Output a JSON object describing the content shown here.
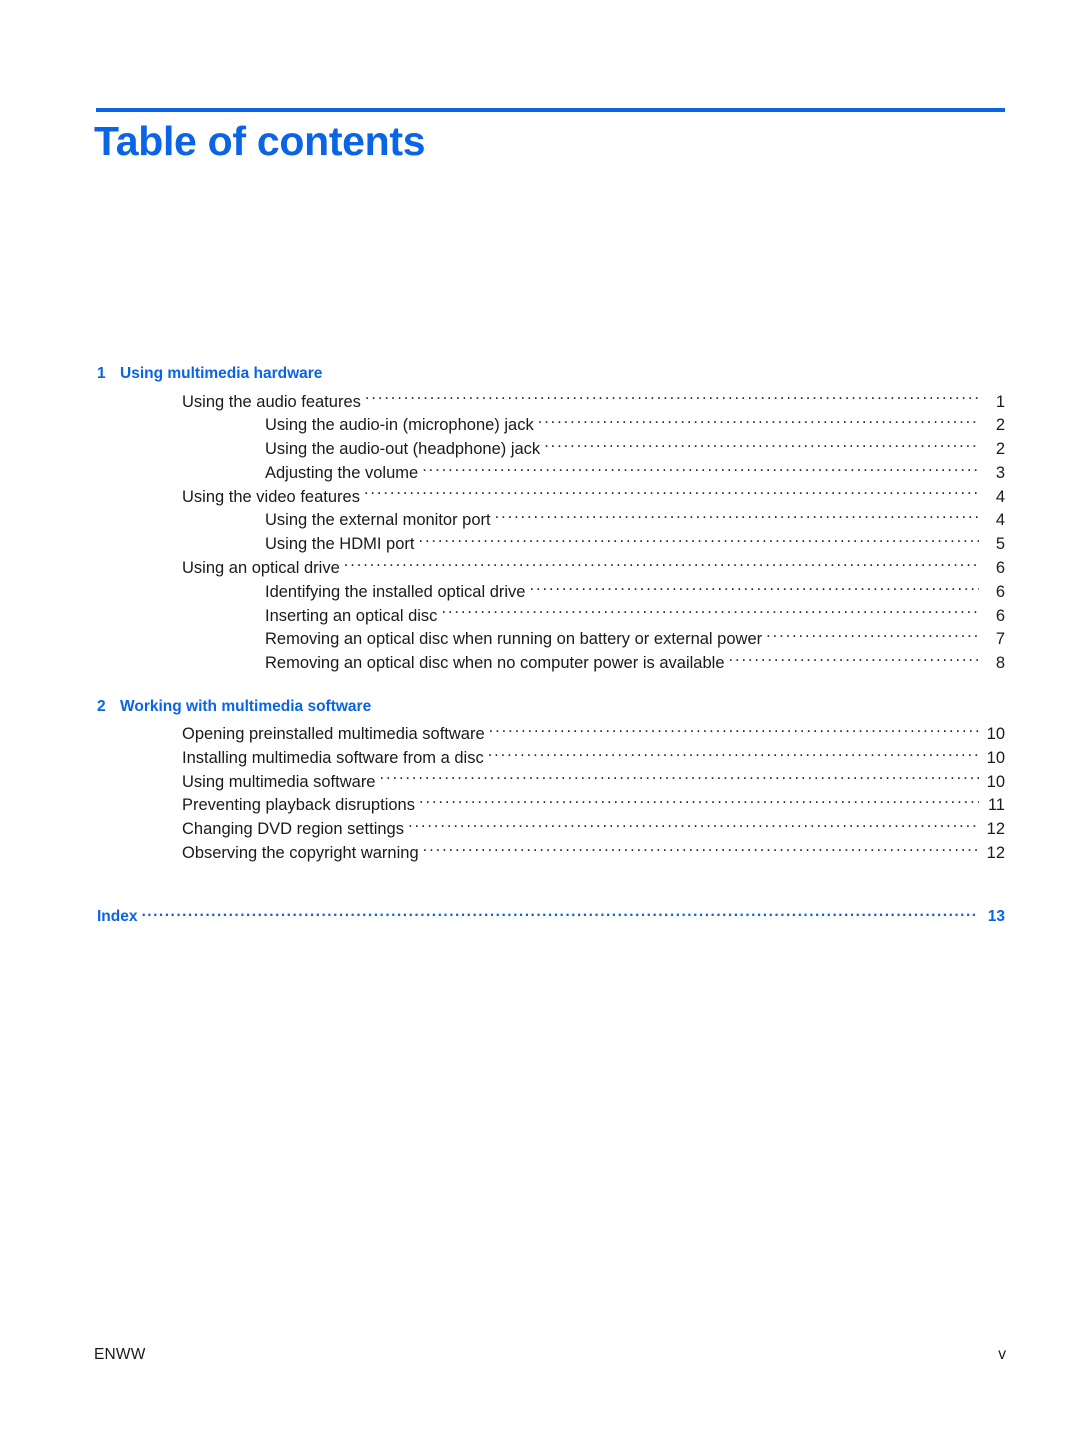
{
  "document": {
    "title": "Table of contents",
    "accent_color": "#0a64e6",
    "body_color": "#1a1a1a"
  },
  "chapters": [
    {
      "number": "1",
      "title": "Using multimedia hardware",
      "entries": [
        {
          "level": 1,
          "label": "Using the audio features",
          "page": "1"
        },
        {
          "level": 2,
          "label": "Using the audio-in (microphone) jack",
          "page": "2"
        },
        {
          "level": 2,
          "label": "Using the audio-out (headphone) jack",
          "page": "2"
        },
        {
          "level": 2,
          "label": "Adjusting the volume",
          "page": "3"
        },
        {
          "level": 1,
          "label": "Using the video features",
          "page": "4"
        },
        {
          "level": 2,
          "label": "Using the external monitor port",
          "page": "4"
        },
        {
          "level": 2,
          "label": "Using the HDMI port",
          "page": "5"
        },
        {
          "level": 1,
          "label": "Using an optical drive",
          "page": "6"
        },
        {
          "level": 2,
          "label": "Identifying the installed optical drive",
          "page": "6"
        },
        {
          "level": 2,
          "label": "Inserting an optical disc",
          "page": "6"
        },
        {
          "level": 2,
          "label": "Removing an optical disc when running on battery or external power",
          "page": "7"
        },
        {
          "level": 2,
          "label": "Removing an optical disc when no computer power is available",
          "page": "8"
        }
      ]
    },
    {
      "number": "2",
      "title": "Working with multimedia software",
      "entries": [
        {
          "level": 1,
          "label": "Opening preinstalled multimedia software",
          "page": "10"
        },
        {
          "level": 1,
          "label": "Installing multimedia software from a disc",
          "page": "10"
        },
        {
          "level": 1,
          "label": "Using multimedia software",
          "page": "10"
        },
        {
          "level": 1,
          "label": "Preventing playback disruptions",
          "page": "11"
        },
        {
          "level": 1,
          "label": "Changing DVD region settings",
          "page": "12"
        },
        {
          "level": 1,
          "label": "Observing the copyright warning",
          "page": "12"
        }
      ]
    }
  ],
  "index": {
    "label": "Index",
    "page": "13"
  },
  "footer": {
    "doc_language": "ENWW",
    "folio": "v"
  }
}
